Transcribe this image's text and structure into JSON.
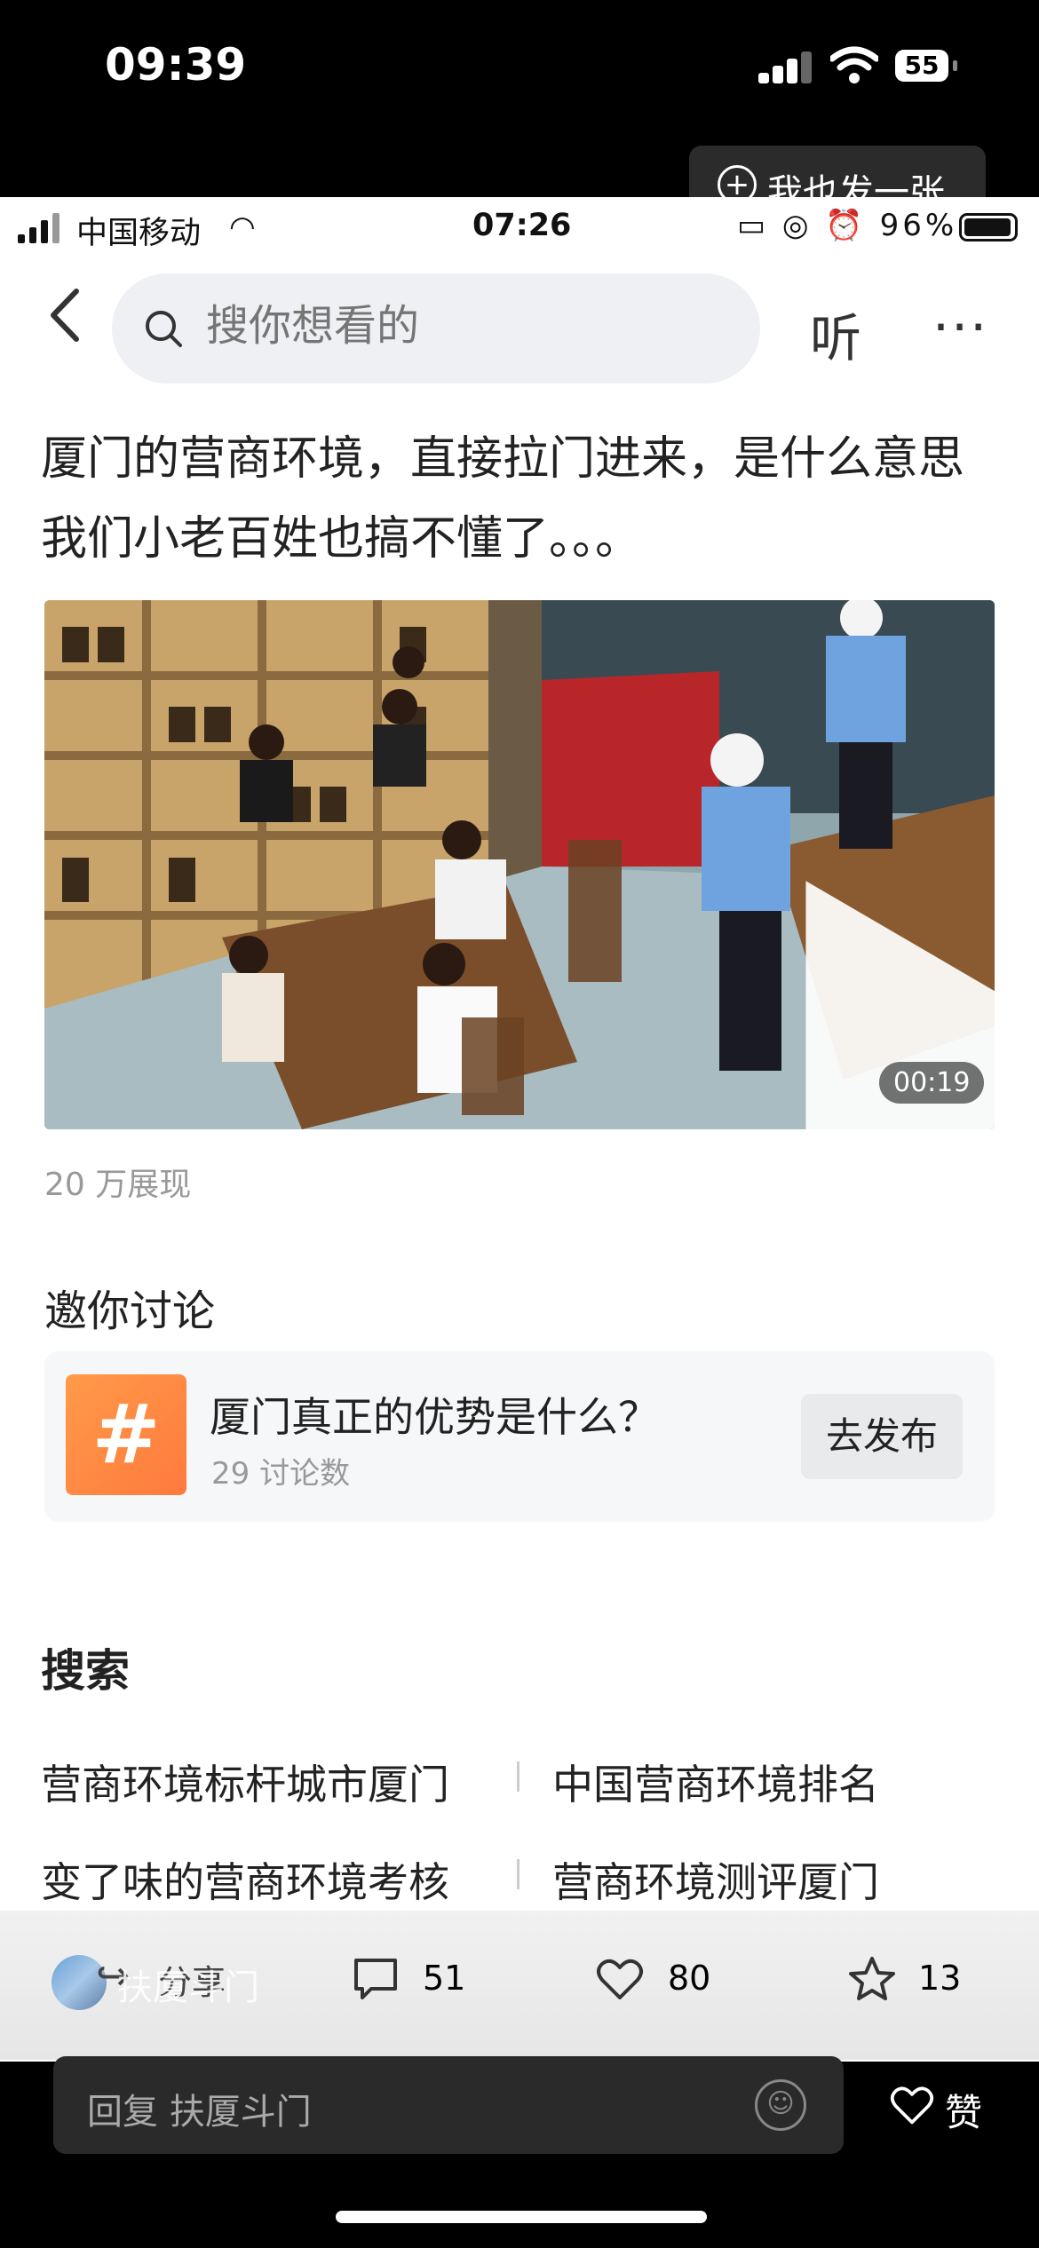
{
  "outer_status": {
    "time": "09:39",
    "battery": "55"
  },
  "post_button": {
    "label": "我也发一张"
  },
  "inner_status": {
    "carrier": "中国移动",
    "time": "07:26",
    "battery": "96%"
  },
  "search": {
    "placeholder": "搜你想看的"
  },
  "nav": {
    "listen_label": "听",
    "more_label": "···"
  },
  "post": {
    "title": "厦门的营商环境，直接拉门进来，是什么意思我们小老百姓也搞不懂了。。。",
    "video_duration": "00:19",
    "views": "20 万展现"
  },
  "invite": {
    "title": "邀你讨论",
    "topic_icon": "#",
    "topic_name": "厦门真正的优势是什么？",
    "topic_count": "29 讨论数",
    "publish_label": "去发布"
  },
  "search_section": {
    "title": "搜索",
    "suggestions": [
      "营商环境标杆城市厦门",
      "中国营商环境排名",
      "变了味的营商环境考核",
      "营商环境测评厦门"
    ]
  },
  "actions": {
    "author": "扶厦斗门",
    "share_label": "分享",
    "comment_count": "51",
    "like_count": "80",
    "favorite_count": "13"
  },
  "reply": {
    "placeholder": "回复 扶厦斗门",
    "like_label": "赞"
  },
  "icons": [
    "back-icon",
    "search-icon",
    "play-icon",
    "share-icon",
    "comment-icon",
    "heart-icon",
    "star-icon",
    "emoji-icon"
  ]
}
